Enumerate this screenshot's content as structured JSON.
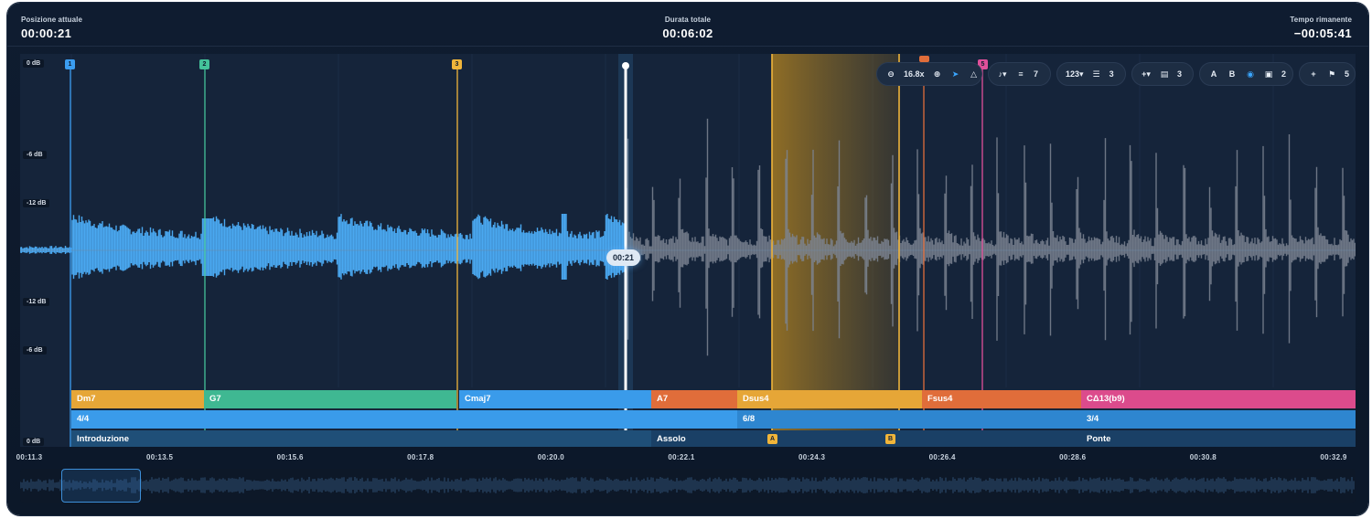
{
  "header": {
    "current_position_label": "Posizione attuale",
    "current_position": "00:00:21",
    "total_duration_label": "Durata totale",
    "total_duration": "00:06:02",
    "remaining_label": "Tempo rimanente",
    "remaining": "−00:05:41"
  },
  "db_scale": [
    "0 dB",
    "-6 dB",
    "-12 dB",
    "-12 dB",
    "-6 dB",
    "0 dB"
  ],
  "toolbar": {
    "zoom_level": "16.8x",
    "note_count": "7",
    "number_label": "123",
    "list_count": "3",
    "text_count": "3",
    "ab_a": "A",
    "ab_b": "B",
    "shape_count": "2",
    "flag_count": "5"
  },
  "markers": [
    {
      "label": "1",
      "color": "#3b9df0"
    },
    {
      "label": "2",
      "color": "#44c29a"
    },
    {
      "label": "3",
      "color": "#f0b53a"
    },
    {
      "label": "4",
      "color": "#e06d3a"
    },
    {
      "label": "5",
      "color": "#e0509a"
    }
  ],
  "playhead_time": "00:21",
  "loop": {
    "a": "A",
    "b": "B"
  },
  "chords": [
    {
      "label": "Dm7",
      "color": "#e6a637"
    },
    {
      "label": "G7",
      "color": "#3fb892"
    },
    {
      "label": "Cmaj7",
      "color": "#3a9bea"
    },
    {
      "label": "A7",
      "color": "#e06d3a"
    },
    {
      "label": "Dsus4",
      "color": "#e6a637"
    },
    {
      "label": "Fsus4",
      "color": "#e06d3a"
    },
    {
      "label": "CΔ13(b9)",
      "color": "#dc4b8c"
    }
  ],
  "time_signatures": [
    {
      "label": "4/4"
    },
    {
      "label": "6/8"
    },
    {
      "label": "3/4"
    }
  ],
  "sections": [
    {
      "label": "Introduzione"
    },
    {
      "label": "Assolo"
    },
    {
      "label": "Ponte"
    }
  ],
  "time_ticks": [
    "00:11.3",
    "00:13.5",
    "00:15.6",
    "00:17.8",
    "00:20.0",
    "00:22.1",
    "00:24.3",
    "00:26.4",
    "00:28.6",
    "00:30.8",
    "00:32.9"
  ],
  "colors": {
    "played_wave": "#4aa8f0",
    "unplayed_wave": "#7d8593",
    "loop_region": "#b8861f",
    "playhead": "#ffffff"
  }
}
